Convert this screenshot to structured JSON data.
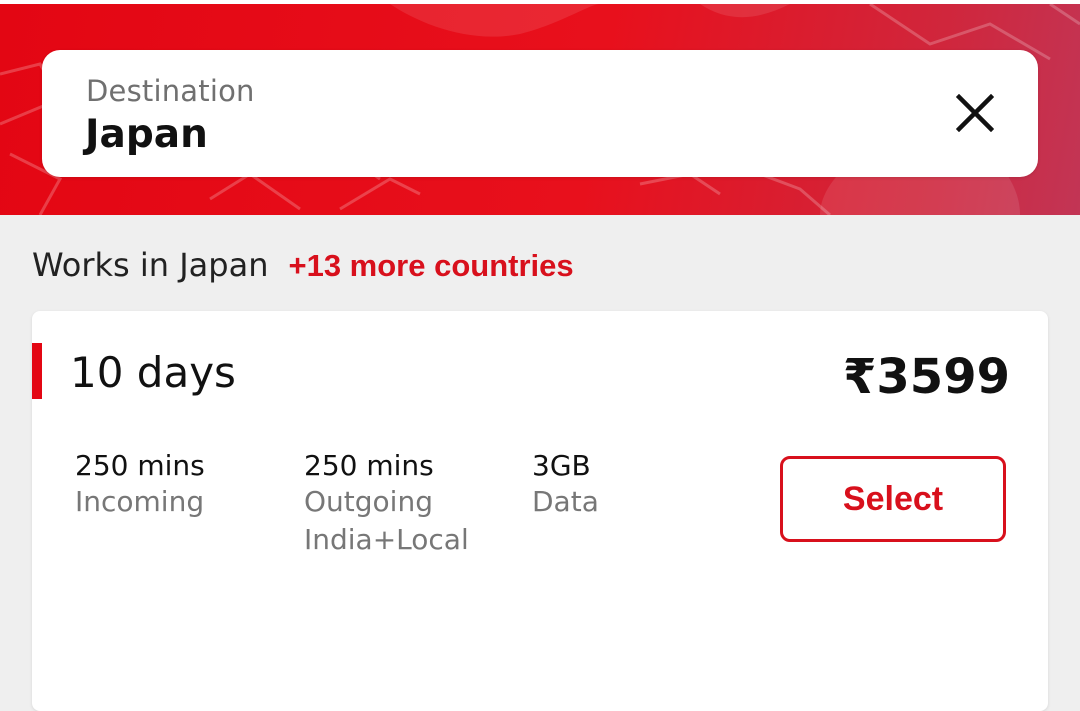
{
  "header": {
    "accent_color": "#e30613",
    "search": {
      "label": "Destination",
      "value": "Japan",
      "clear_icon": "close-icon"
    }
  },
  "coverage": {
    "text": "Works in Japan",
    "more_link": "+13 more countries"
  },
  "plan": {
    "duration": "10 days",
    "price": "₹3599",
    "features": [
      {
        "value": "250 mins",
        "label": "Incoming"
      },
      {
        "value": "250 mins",
        "label": "Outgoing India+Local"
      },
      {
        "value": "3GB",
        "label": "Data"
      }
    ],
    "select_label": "Select"
  }
}
